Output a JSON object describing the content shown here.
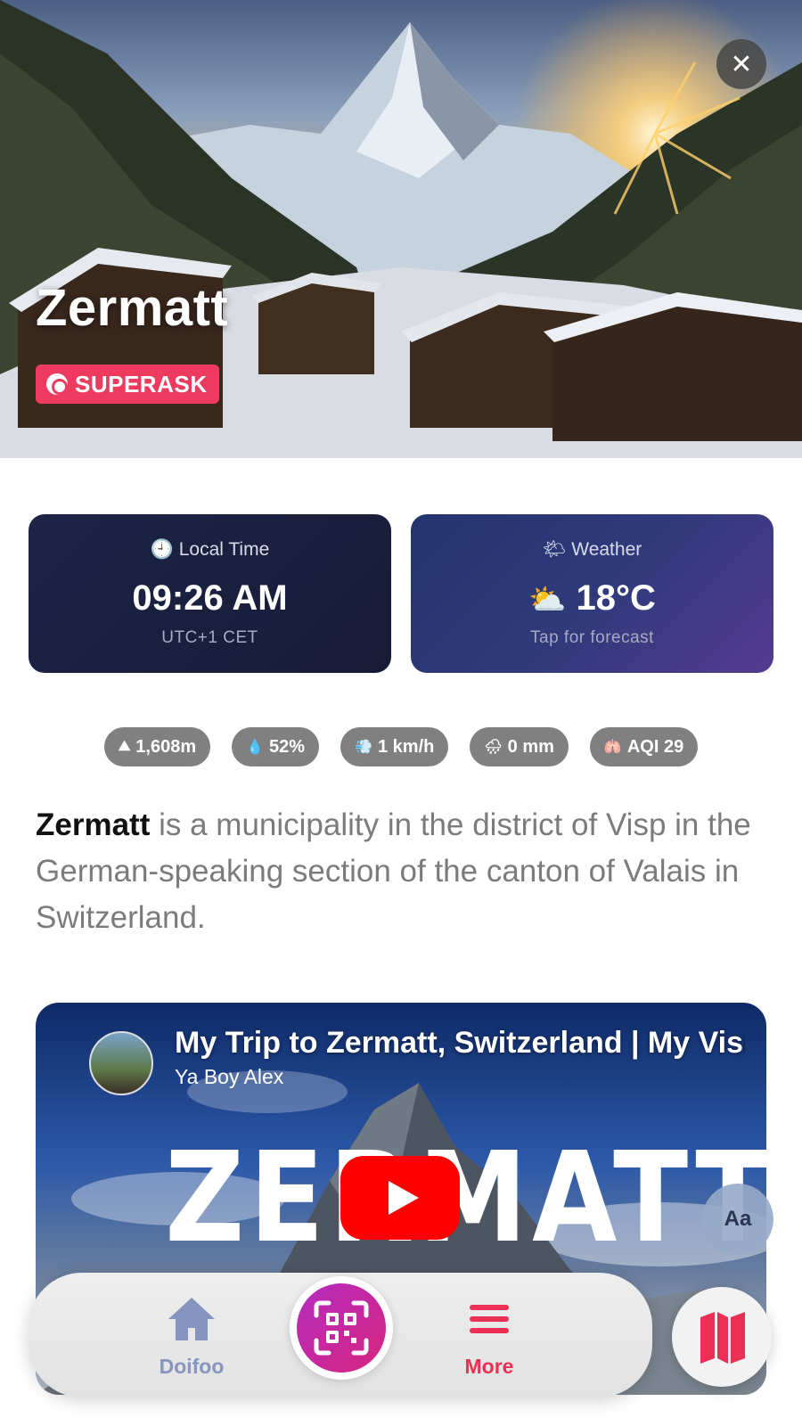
{
  "hero": {
    "title": "Zermatt",
    "badge_label": "SUPERASK",
    "close_label": "✕"
  },
  "cards": {
    "time": {
      "label": "Local Time",
      "value": "09:26 AM",
      "sub": "UTC+1 CET"
    },
    "weather": {
      "label": "Weather",
      "value": "18°C",
      "sub": "Tap for forecast"
    }
  },
  "stats": [
    {
      "icon": "mountain-icon",
      "glyph": "⛰",
      "label": "1,608m"
    },
    {
      "icon": "droplet-icon",
      "glyph": "💧",
      "label": "52%"
    },
    {
      "icon": "wind-icon",
      "glyph": "💨",
      "label": "1 km/h"
    },
    {
      "icon": "rain-icon",
      "glyph": "🌧",
      "label": "0 mm"
    },
    {
      "icon": "lungs-icon",
      "glyph": "🫁",
      "label": "AQI 29"
    }
  ],
  "description": {
    "bold": "Zermatt",
    "rest": " is a municipality in the district of Visp in the German-speaking section of the canton of Valais in Switzerland."
  },
  "video": {
    "title": "My Trip to Zermatt, Switzerland | My Visit",
    "channel": "Ya Boy Alex",
    "thumbnail_text": "ZERMATT"
  },
  "floating": {
    "font_button": "Aa"
  },
  "nav": {
    "home_label": "Doifoo",
    "more_label": "More"
  },
  "colors": {
    "accent": "#ec2f55",
    "badge": "#ee3a5e",
    "time_card": "#1b2142",
    "weather_card": "#3a3c85",
    "nav_home": "#8595bf",
    "qr_gradient_start": "#b32bbf",
    "qr_gradient_end": "#d8267f"
  }
}
